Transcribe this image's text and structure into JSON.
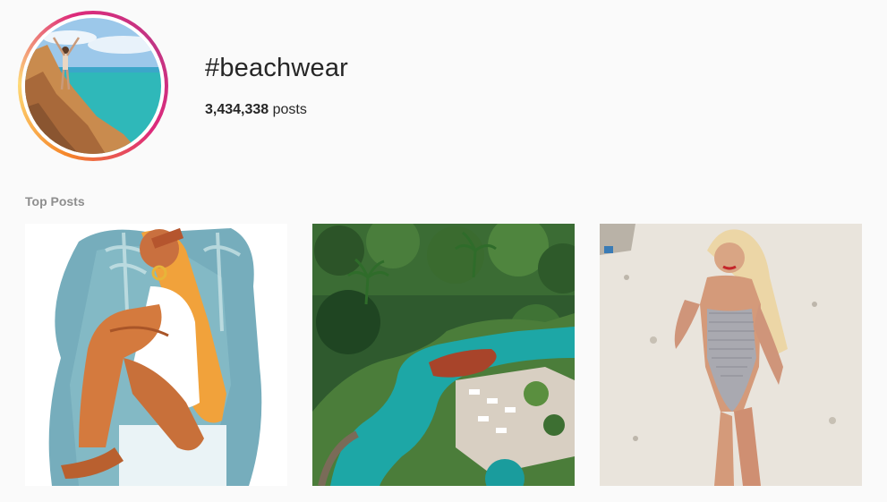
{
  "header": {
    "hashtag": "#beachwear",
    "post_count": "3,434,338",
    "post_suffix": " posts",
    "avatar_icon": "profile-photo-beach"
  },
  "top_posts": {
    "title": "Top Posts",
    "items": [
      {
        "id": "post-1",
        "kind": "illustration-woman-sitting"
      },
      {
        "id": "post-2",
        "kind": "resort-pool-aerial"
      },
      {
        "id": "post-3",
        "kind": "woman-swimsuit-beach"
      }
    ]
  },
  "colors": {
    "ring_start": "#f58529",
    "ring_end": "#c13584",
    "page_bg": "#fafafa",
    "muted_text": "#8e8e8e"
  }
}
